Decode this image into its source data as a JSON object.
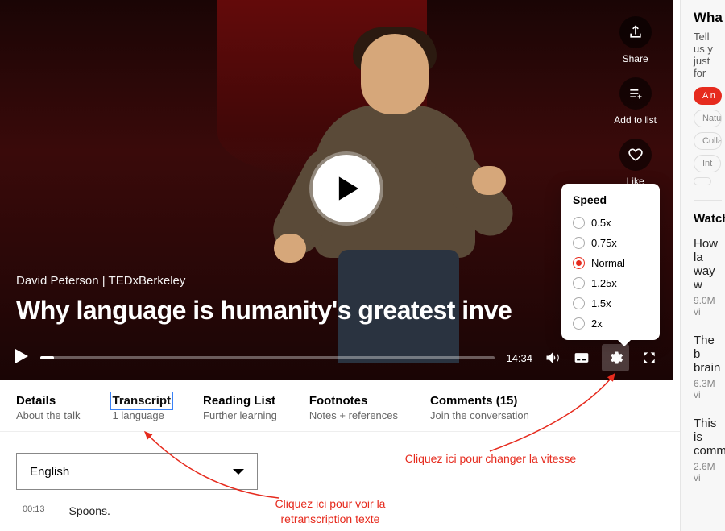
{
  "video": {
    "speaker": "David Peterson",
    "event": "TEDxBerkeley",
    "separator": " | ",
    "title": "Why language is humanity's greatest inve",
    "duration": "14:34"
  },
  "actions": {
    "share": "Share",
    "add": "Add to list",
    "like": "Like"
  },
  "speed": {
    "heading": "Speed",
    "options": [
      "0.5x",
      "0.75x",
      "Normal",
      "1.25x",
      "1.5x",
      "2x"
    ],
    "selected_index": 2
  },
  "tabs": [
    {
      "title": "Details",
      "sub": "About the talk"
    },
    {
      "title": "Transcript",
      "sub": "1 language"
    },
    {
      "title": "Reading List",
      "sub": "Further learning"
    },
    {
      "title": "Footnotes",
      "sub": "Notes + references"
    },
    {
      "title": "Comments (15)",
      "sub": "Join the conversation"
    }
  ],
  "language_selector": {
    "value": "English"
  },
  "transcript": {
    "time0": "00:13",
    "line0": "Spoons."
  },
  "annotations": {
    "speed_hint": "Cliquez ici pour changer la vitesse",
    "transcript_hint": "Cliquez ici pour voir la retranscription texte"
  },
  "sidebar": {
    "heading": "Wha",
    "subtext": "Tell us y just for",
    "pills": [
      {
        "label": "A n",
        "red": true
      },
      {
        "label": "Natu",
        "red": false
      },
      {
        "label": "Collab",
        "red": false
      },
      {
        "label": "Int",
        "red": false
      },
      {
        "label": "",
        "red": false
      }
    ],
    "watch_heading": "Watch",
    "recs": [
      {
        "title": "How la way w",
        "views": "9.0M vi"
      },
      {
        "title": "The b brain",
        "views": "6.3M vi"
      },
      {
        "title": "This is comm",
        "views": "2.6M vi"
      }
    ]
  }
}
